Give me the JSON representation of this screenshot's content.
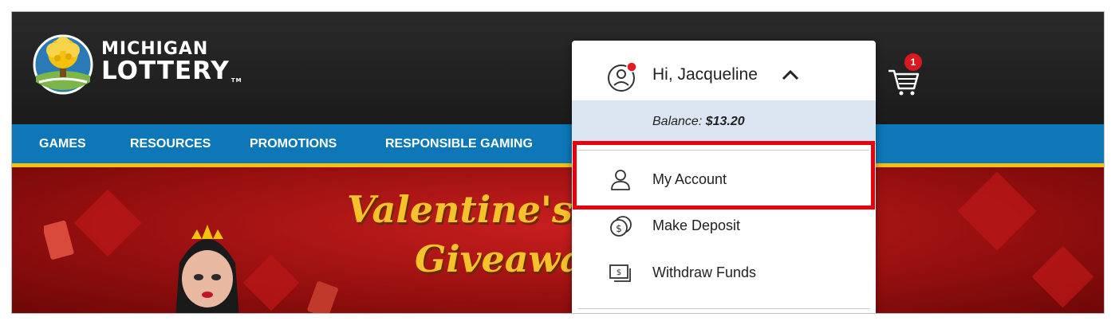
{
  "logo": {
    "line1": "MICHIGAN",
    "line2": "LOTTERY",
    "tm": "TM"
  },
  "nav": {
    "items": [
      "GAMES",
      "RESOURCES",
      "PROMOTIONS",
      "RESPONSIBLE GAMING"
    ]
  },
  "banner": {
    "title_line1": "Valentine's R",
    "title_line2": "Giveaway"
  },
  "cart": {
    "icon": "shopping-cart-icon",
    "badge_count": "1",
    "badge_color": "#d71920"
  },
  "account_menu": {
    "greeting": "Hi, Jacqueline",
    "user_icon": "user-circle-icon",
    "notification_dot_color": "#e31b23",
    "expand_icon": "chevron-up-icon",
    "balance_label": "Balance:",
    "balance_value": "$13.20",
    "items": [
      {
        "label": "My Account",
        "icon": "user-icon",
        "highlighted": true
      },
      {
        "label": "Make Deposit",
        "icon": "coin-deposit-icon",
        "highlighted": false
      },
      {
        "label": "Withdraw Funds",
        "icon": "cash-withdraw-icon",
        "highlighted": false
      }
    ]
  },
  "colors": {
    "nav_blue": "#0d77b8",
    "nav_underline_yellow": "#f2c20f",
    "highlight_red": "#e8000b",
    "balance_bg": "#dce6f3"
  }
}
